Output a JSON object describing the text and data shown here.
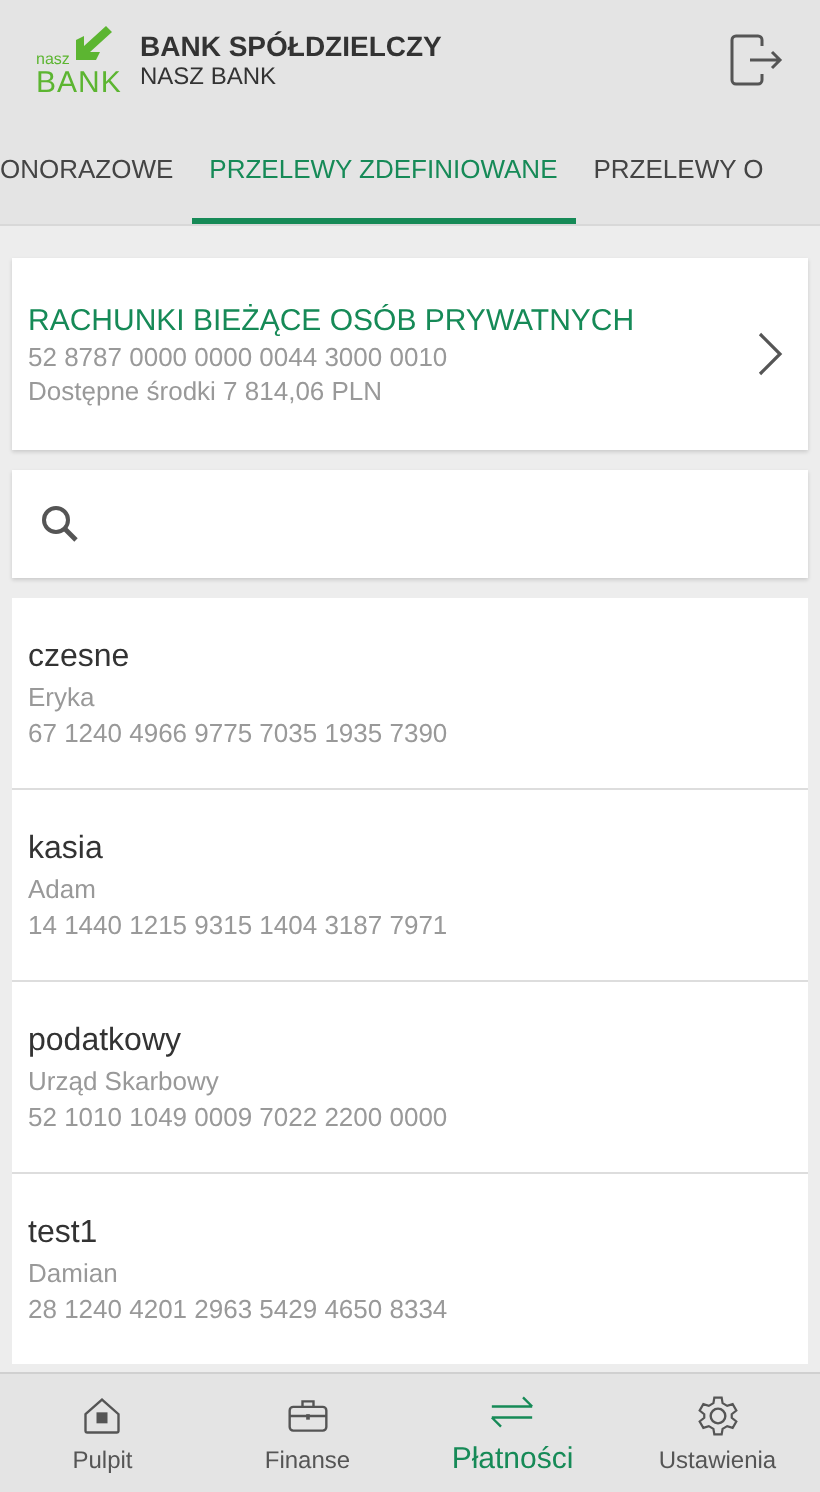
{
  "header": {
    "logo_small": "nasz",
    "logo_big": "BANK",
    "title": "BANK SPÓŁDZIELCZY",
    "subtitle": "NASZ BANK"
  },
  "tabs": [
    {
      "label": "ONORAZOWE",
      "selected": false
    },
    {
      "label": "PRZELEWY ZDEFINIOWANE",
      "selected": true
    },
    {
      "label": "PRZELEWY O",
      "selected": false
    }
  ],
  "account": {
    "name": "RACHUNKI BIEŻĄCE OSÓB PRYWATNYCH",
    "number": "52 8787 0000 0000 0044 3000 0010",
    "balance": "Dostępne środki 7 814,06 PLN"
  },
  "transfers": [
    {
      "name": "czesne",
      "recipient": "Eryka",
      "account": "67 1240 4966 9775 7035 1935 7390"
    },
    {
      "name": "kasia",
      "recipient": "Adam",
      "account": "14 1440 1215 9315 1404 3187 7971"
    },
    {
      "name": "podatkowy",
      "recipient": "Urząd Skarbowy",
      "account": "52 1010 1049 0009 7022 2200 0000"
    },
    {
      "name": "test1",
      "recipient": "Damian",
      "account": "28 1240 4201 2963 5429 4650 8334"
    }
  ],
  "nav": [
    {
      "kind": "home",
      "label": "Pulpit",
      "selected": false
    },
    {
      "kind": "briefcase",
      "label": "Finanse",
      "selected": false
    },
    {
      "kind": "transfer",
      "label": "Płatności",
      "selected": true
    },
    {
      "kind": "gear",
      "label": "Ustawienia",
      "selected": false
    }
  ]
}
